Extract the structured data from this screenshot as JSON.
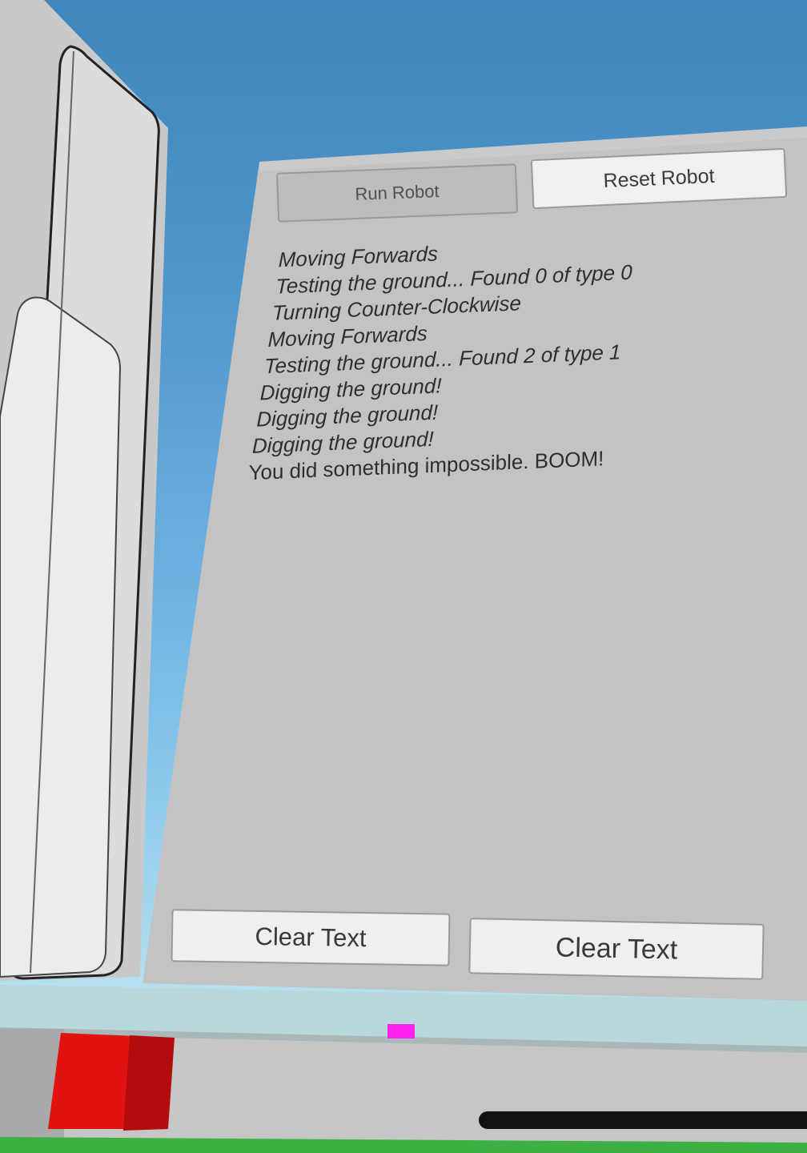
{
  "controls": {
    "run_label": "Run Robot",
    "reset_label": "Reset Robot",
    "clear_label_1": "Clear Text",
    "clear_label_2": "Clear Text"
  },
  "log": [
    "Moving Forwards",
    "Testing the ground... Found 0 of type 0",
    "Turning Counter-Clockwise",
    "Moving Forwards",
    "Testing the ground... Found 2 of type 1",
    "Digging the ground!",
    "Digging the ground!",
    "Digging the ground!",
    "You did something impossible. BOOM!"
  ],
  "colors": {
    "sky_top": "#3f86bd",
    "panel": "#c3c3c3",
    "cube": "#e01212",
    "marker": "#ff22ee"
  }
}
